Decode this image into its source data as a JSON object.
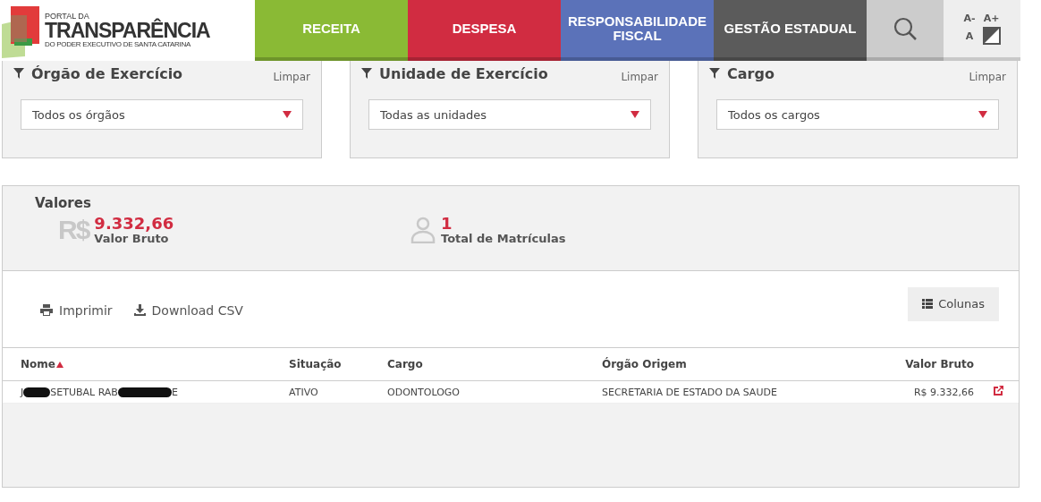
{
  "logo": {
    "line1": "PORTAL DA",
    "line2": "TRANSPARÊNCIA",
    "line3": "DO PODER EXECUTIVO DE SANTA CATARINA"
  },
  "nav": [
    {
      "label": "RECEITA",
      "color": "#8aba35"
    },
    {
      "label": "DESPESA",
      "color": "#d12c41"
    },
    {
      "label": "RESPONSABILIDADE FISCAL",
      "color": "#5b72b9"
    },
    {
      "label": "GESTÃO ESTADUAL",
      "color": "#5b5b5b"
    }
  ],
  "font_tools": {
    "decrease": "A-",
    "increase": "A+",
    "reset": "A"
  },
  "filters": [
    {
      "title": "Órgão de Exercício",
      "clear": "Limpar",
      "value": "Todos os órgãos"
    },
    {
      "title": "Unidade de Exercício",
      "clear": "Limpar",
      "value": "Todas as unidades"
    },
    {
      "title": "Cargo",
      "clear": "Limpar",
      "value": "Todos os cargos"
    }
  ],
  "values": {
    "title": "Valores",
    "items": [
      {
        "kind": "money",
        "value": "9.332,66",
        "label": "Valor Bruto",
        "symbol": "R$"
      },
      {
        "kind": "person",
        "value": "1",
        "label": "Total de Matrículas"
      }
    ]
  },
  "actions": [
    {
      "kind": "print",
      "label": "Imprimir"
    },
    {
      "kind": "download",
      "label": "Download CSV"
    }
  ],
  "columns_button": "Colunas",
  "table": {
    "columns": [
      {
        "label": "Nome",
        "sorted": true
      },
      {
        "label": "Situação",
        "sorted": false
      },
      {
        "label": "Cargo",
        "sorted": false
      },
      {
        "label": "Órgão Origem",
        "sorted": false
      },
      {
        "label": "Valor Bruto",
        "sorted": false
      }
    ],
    "rows": [
      {
        "name_parts": [
          "J",
          "SETUBAL RAB",
          "E"
        ],
        "situacao": "ATIVO",
        "cargo": "ODONTOLOGO",
        "orgao": "SECRETARIA DE ESTADO DA SAUDE",
        "valor": "R$ 9.332,66"
      }
    ]
  }
}
